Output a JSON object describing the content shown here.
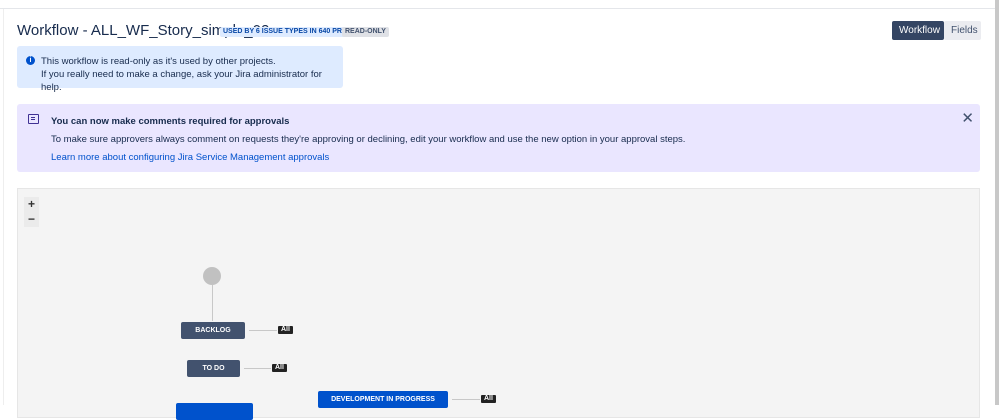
{
  "header": {
    "title": "Workflow - ALL_WF_Story_simple_02",
    "usage_badge": "USED BY 6 ISSUE TYPES IN 640 PROJECTS",
    "readonly_badge": "READ-ONLY"
  },
  "view_toggle": {
    "workflow": "Workflow",
    "fields": "Fields"
  },
  "info": {
    "line1": "This workflow is read-only as it's used by other projects.",
    "line2": "If you really need to make a change, ask your Jira administrator for help."
  },
  "banner": {
    "heading": "You can now make comments required for approvals",
    "text": "To make sure approvers always comment on requests they're approving or declining, edit your workflow and use the new option in your approval steps.",
    "link": "Learn more about configuring Jira Service Management approvals",
    "close": "✕"
  },
  "diagram": {
    "zoom_in": "+",
    "zoom_out": "−",
    "statuses": [
      "BACKLOG",
      "TO DO",
      "DEVELOPMENT IN PROGRESS"
    ],
    "all_label": "All"
  }
}
